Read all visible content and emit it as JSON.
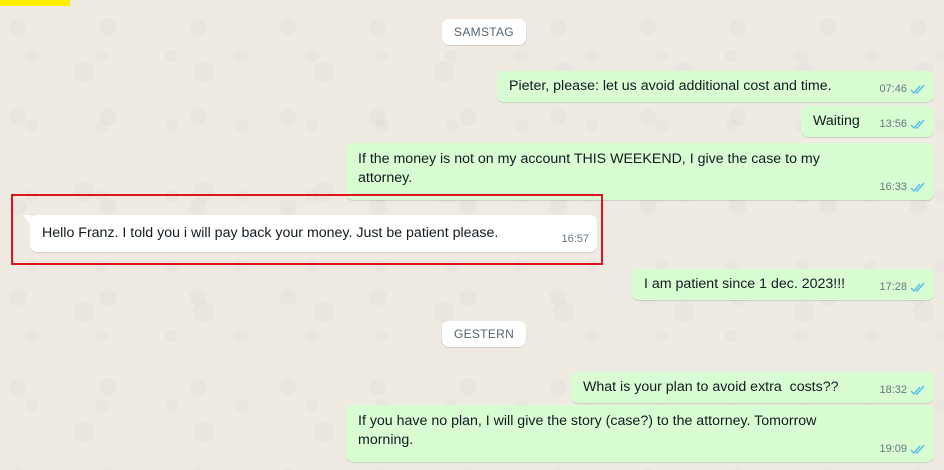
{
  "date_separators": {
    "first": "SAMSTAG",
    "second": "GESTERN"
  },
  "messages": [
    {
      "direction": "outgoing",
      "text": "Pieter, please: let us avoid additional cost and time.",
      "time": "07:46",
      "status": "read"
    },
    {
      "direction": "outgoing",
      "text": "Waiting",
      "time": "13:56",
      "status": "read"
    },
    {
      "direction": "outgoing",
      "text": "If the money is not on my account THIS WEEKEND, I give the case to my attorney.",
      "time": "16:33",
      "status": "read"
    },
    {
      "direction": "incoming",
      "text": "Hello Franz. I told you i will pay back your money. Just be patient please.",
      "time": "16:57",
      "highlighted": true
    },
    {
      "direction": "outgoing",
      "text": "I am patient since 1 dec. 2023!!!",
      "time": "17:28",
      "status": "read"
    },
    {
      "direction": "outgoing",
      "text": "What is your plan to avoid extra  costs??",
      "time": "18:32",
      "status": "read"
    },
    {
      "direction": "outgoing",
      "text": "If you have no plan, I will give the story (case?) to the attorney. Tomorrow morning.",
      "time": "19:09",
      "status": "read"
    }
  ],
  "colors": {
    "outgoing_bubble": "#d9fdd3",
    "incoming_bubble": "#ffffff",
    "read_ticks": "#53bdeb",
    "highlight_border": "#e0141e",
    "corner_mark": "#ffee00"
  },
  "icons": {
    "read_status": "double-check-icon"
  }
}
